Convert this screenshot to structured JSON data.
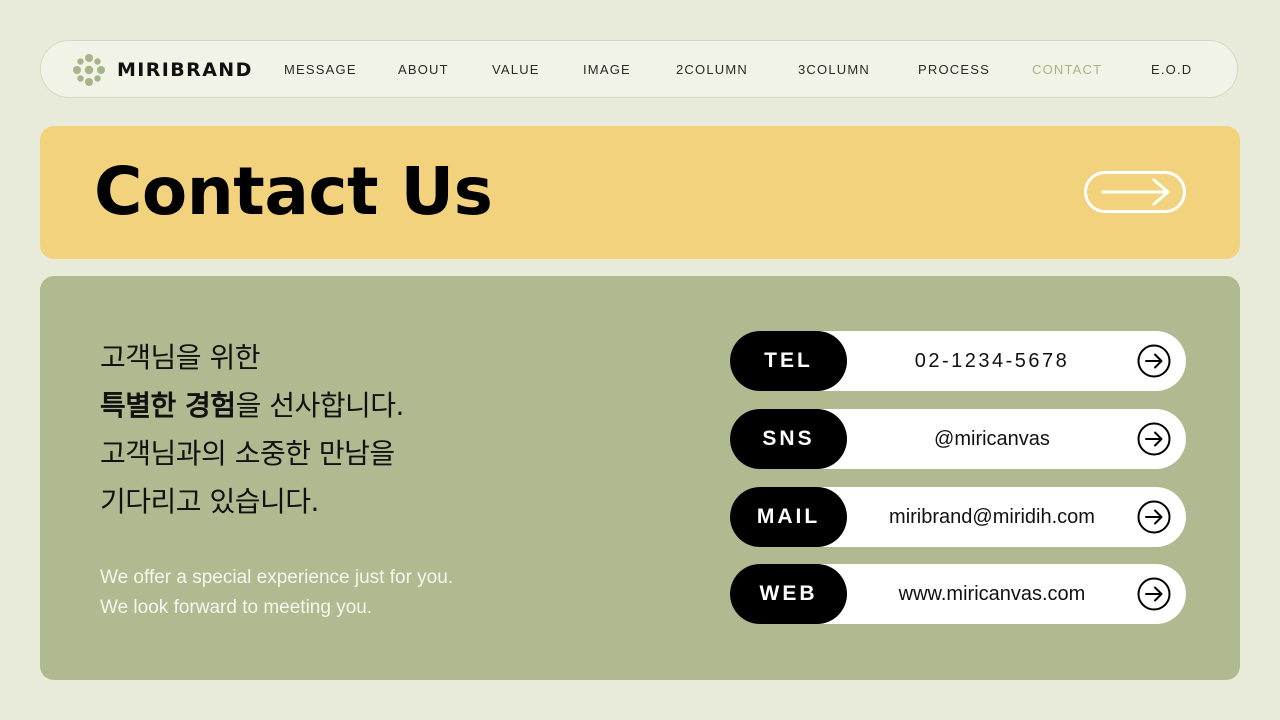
{
  "nav": {
    "brand": "MIRIBRAND",
    "logo_icon": "flower-icon",
    "items": [
      "MESSAGE",
      "ABOUT",
      "VALUE",
      "IMAGE",
      "2COLUMN",
      "3COLUMN",
      "PROCESS",
      "CONTACT",
      "E.O.D"
    ],
    "active": "CONTACT",
    "active_color": "#a9b38a"
  },
  "hero": {
    "title": "Contact Us",
    "arrow_icon": "arrow-right-icon",
    "background": "#f2d27d"
  },
  "message": {
    "kr_line1": "고객님을 위한",
    "kr_line2_bold": "특별한 경험",
    "kr_line2_rest": "을 선사합니다.",
    "kr_line3": "고객님과의 소중한 만남을",
    "kr_line4": "기다리고 있습니다.",
    "en_line1": "We offer a special experience just for you.",
    "en_line2": "We look forward to meeting you."
  },
  "contacts": [
    {
      "label": "TEL",
      "value": "02-1234-5678",
      "icon": "circle-arrow-right-icon"
    },
    {
      "label": "SNS",
      "value": "@miricanvas",
      "icon": "circle-arrow-right-icon"
    },
    {
      "label": "MAIL",
      "value": "miribrand@miridih.com",
      "icon": "circle-arrow-right-icon"
    },
    {
      "label": "WEB",
      "value": "www.miricanvas.com",
      "icon": "circle-arrow-right-icon"
    }
  ],
  "colors": {
    "page_bg": "#e8ebd9",
    "panel_bg": "#b0b98f",
    "nav_bg": "#f1f3e6"
  }
}
